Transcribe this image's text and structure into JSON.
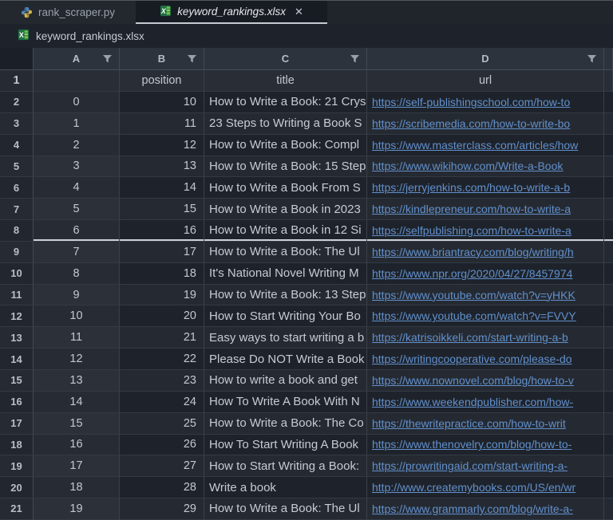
{
  "tabs": [
    {
      "label": "rank_scraper.py",
      "icon": "python-file-icon",
      "active": false
    },
    {
      "label": "keyword_rankings.xlsx",
      "icon": "excel-file-icon",
      "active": true,
      "close_glyph": "✕"
    }
  ],
  "breadcrumb": {
    "label": "keyword_rankings.xlsx",
    "icon": "excel-file-icon"
  },
  "grid": {
    "columns": [
      {
        "letter": "A",
        "filter": true
      },
      {
        "letter": "B",
        "filter": true
      },
      {
        "letter": "C",
        "filter": true
      },
      {
        "letter": "D",
        "filter": true
      }
    ],
    "header_row_number": "1",
    "header_labels": {
      "a": "",
      "b": "position",
      "c": "title",
      "d": "url"
    },
    "divider_below_row": "8",
    "rows": [
      {
        "row": "2",
        "index": "0",
        "position": "10",
        "title": "How to Write a Book: 21 Crys",
        "url": "https://self-publishingschool.com/how-to"
      },
      {
        "row": "3",
        "index": "1",
        "position": "11",
        "title": "23 Steps to Writing a Book S",
        "url": "https://scribemedia.com/how-to-write-bo"
      },
      {
        "row": "4",
        "index": "2",
        "position": "12",
        "title": "How to Write a Book: Compl",
        "url": "https://www.masterclass.com/articles/how"
      },
      {
        "row": "5",
        "index": "3",
        "position": "13",
        "title": "How to Write a Book: 15 Step",
        "url": "https://www.wikihow.com/Write-a-Book"
      },
      {
        "row": "6",
        "index": "4",
        "position": "14",
        "title": "How to Write a Book From S",
        "url": "https://jerryjenkins.com/how-to-write-a-b"
      },
      {
        "row": "7",
        "index": "5",
        "position": "15",
        "title": "How to Write a Book in 2023",
        "url": "https://kindlepreneur.com/how-to-write-a"
      },
      {
        "row": "8",
        "index": "6",
        "position": "16",
        "title": "How to Write a Book in 12 Si",
        "url": "https://selfpublishing.com/how-to-write-a"
      },
      {
        "row": "9",
        "index": "7",
        "position": "17",
        "title": "How to Write a Book: The Ul",
        "url": "https://www.briantracy.com/blog/writing/h"
      },
      {
        "row": "10",
        "index": "8",
        "position": "18",
        "title": "It's National Novel Writing M",
        "url": "https://www.npr.org/2020/04/27/8457974"
      },
      {
        "row": "11",
        "index": "9",
        "position": "19",
        "title": "How to Write a Book: 13 Step",
        "url": "https://www.youtube.com/watch?v=yHKK"
      },
      {
        "row": "12",
        "index": "10",
        "position": "20",
        "title": "How to Start Writing Your Bo",
        "url": "https://www.youtube.com/watch?v=FVVY"
      },
      {
        "row": "13",
        "index": "11",
        "position": "21",
        "title": "Easy ways to start writing a b",
        "url": "https://katrisoikkeli.com/start-writing-a-b"
      },
      {
        "row": "14",
        "index": "12",
        "position": "22",
        "title": "Please Do NOT Write a Book",
        "url": "https://writingcooperative.com/please-do"
      },
      {
        "row": "15",
        "index": "13",
        "position": "23",
        "title": "How to write a book and get",
        "url": "https://www.nownovel.com/blog/how-to-v"
      },
      {
        "row": "16",
        "index": "14",
        "position": "24",
        "title": "How To Write A Book With N",
        "url": "https://www.weekendpublisher.com/how-"
      },
      {
        "row": "17",
        "index": "15",
        "position": "25",
        "title": "How to Write a Book: The Co",
        "url": "https://thewritepractice.com/how-to-writ"
      },
      {
        "row": "18",
        "index": "16",
        "position": "26",
        "title": "How To Start Writing A Book",
        "url": "https://www.thenovelry.com/blog/how-to-"
      },
      {
        "row": "19",
        "index": "17",
        "position": "27",
        "title": "How to Start Writing a Book:",
        "url": "https://prowritingaid.com/start-writing-a-"
      },
      {
        "row": "20",
        "index": "18",
        "position": "28",
        "title": "Write a book",
        "url": "http://www.createmybooks.com/US/en/wr"
      },
      {
        "row": "21",
        "index": "19",
        "position": "29",
        "title": "How to Write a Book: The Ul",
        "url": "https://www.grammarly.com/blog/write-a-"
      }
    ]
  },
  "colors": {
    "background": "#1d222a",
    "tab_active_underline": "#c6cbd2",
    "grid_header_bg": "#2d333c",
    "url_link": "#6290cc",
    "excel_green": "#1f7044",
    "python_blue": "#4f87b8",
    "python_yellow": "#d8b84a"
  }
}
